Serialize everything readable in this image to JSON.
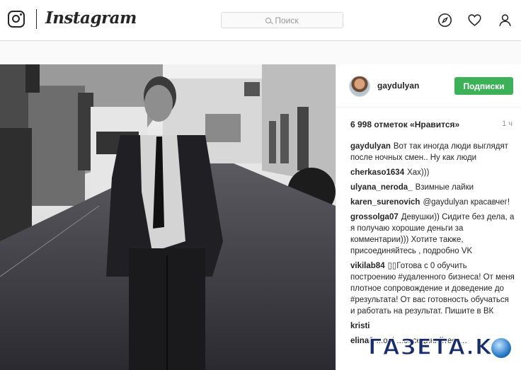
{
  "header": {
    "brand": "Instagram",
    "search_placeholder": "Поиск",
    "icons": [
      "instagram-logo-icon",
      "compass-icon",
      "heart-icon",
      "profile-icon"
    ]
  },
  "post": {
    "image_desc_icon": "photo",
    "author": "gaydulyan",
    "follow_label": "Подписки",
    "likes": "6 998 отметок «Нравится»",
    "time": "1 ч",
    "comments": [
      {
        "user": "gaydulyan",
        "text": "Вот так иногда люди выглядят после ночных смен.. Ну как люди"
      },
      {
        "user": "cherkaso1634",
        "text": "Хах)))"
      },
      {
        "user": "ulyana_neroda_",
        "text": "Взимные лайки"
      },
      {
        "user": "karen_surenovich",
        "text": "@gaydulyan красавчег!"
      },
      {
        "user": "grossolga07",
        "text": "Девушки)) Сидите без дела, а я получаю хорошие деньги за комментарии))) Хотите также, присоединяйтесь , подробно VK"
      },
      {
        "user": "vikilab84",
        "text": "▯▯Готова с 0 обучить построению #удаленного бизнеса! От меня плотное сопровождение и доведение до #результата! От вас готовность обучаться и работать на результат. Пишите в ВК"
      },
      {
        "user": "kristi",
        "text": ""
      },
      {
        "user": "elina8",
        "text": "...оо!    ...оесединяйтесь..."
      }
    ]
  },
  "watermark": {
    "text": "ГАЗЕТА.KG"
  },
  "colors": {
    "accent": "#3db157",
    "border": "#dbdbdb",
    "text": "#262626",
    "muted": "#999999"
  }
}
